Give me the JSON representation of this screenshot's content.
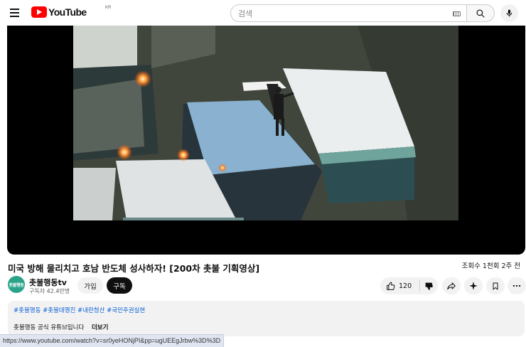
{
  "header": {
    "logo_text": "YouTube",
    "logo_country": "KR",
    "search_placeholder": "검색"
  },
  "video": {
    "title": "미국 방해 물리치고 호남 반도체 성사하자! [200차 촛불 기획영상]",
    "views": "조회수 1천회  2주 전"
  },
  "channel": {
    "avatar_text": "촛불행동",
    "name": "촛불행동tv",
    "subscribers": "구독자 42.4만명",
    "join_label": "가입",
    "subscribe_label": "구독"
  },
  "actions": {
    "like_count": "120"
  },
  "description": {
    "hashtags": "#촛불행동 #촛불대행진 #내란청산 #국민주권실현",
    "text": "촛불행동 공식 유튜브입니다",
    "more_label": "더보기"
  },
  "status_url": "https://www.youtube.com/watch?v=sr0yeHONjPI&pp=ugUEEgJrbw%3D%3D"
}
